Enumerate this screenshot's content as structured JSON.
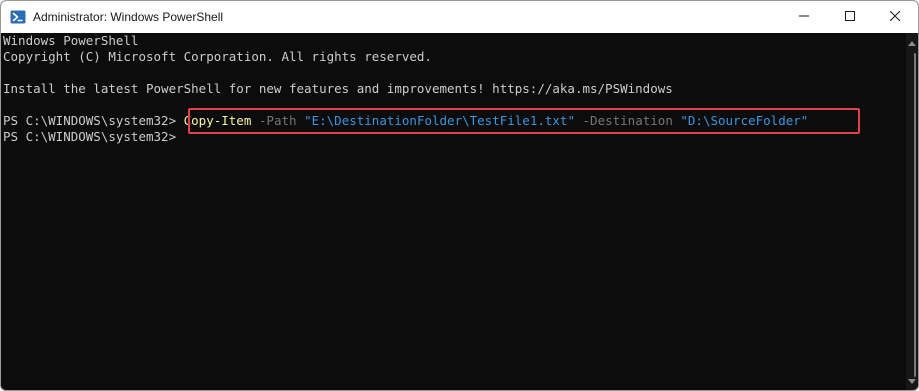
{
  "window": {
    "title": "Administrator: Windows PowerShell",
    "app_icon": "powershell-icon",
    "controls": [
      "minimize-icon",
      "maximize-icon",
      "close-icon"
    ]
  },
  "console": {
    "line1": "Windows PowerShell",
    "line2": "Copyright (C) Microsoft Corporation. All rights reserved.",
    "line3": "Install the latest PowerShell for new features and improvements! https://aka.ms/PSWindows",
    "prompt1": "PS C:\\WINDOWS\\system32> ",
    "command": {
      "cmdlet": "Copy-Item",
      "param1": "-Path",
      "value1": "\"E:\\DestinationFolder\\TestFile1.txt\"",
      "param2": "-Destination",
      "value2": "\"D:\\SourceFolder\""
    },
    "prompt2": "PS C:\\WINDOWS\\system32>"
  },
  "colors": {
    "background": "#0c0c0c",
    "text": "#cccccc",
    "cmdlet": "#f9f1a5",
    "parameter": "#767676",
    "string": "#3a96dd",
    "highlight_border": "#e0404a"
  }
}
